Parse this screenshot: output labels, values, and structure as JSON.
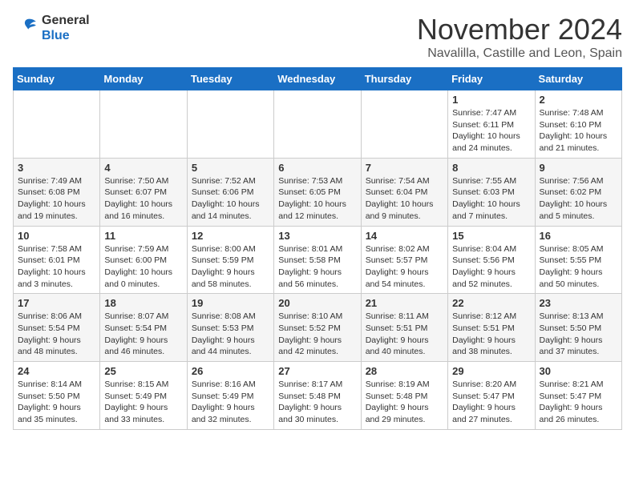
{
  "logo": {
    "line1": "General",
    "line2": "Blue"
  },
  "title": "November 2024",
  "location": "Navalilla, Castille and Leon, Spain",
  "weekdays": [
    "Sunday",
    "Monday",
    "Tuesday",
    "Wednesday",
    "Thursday",
    "Friday",
    "Saturday"
  ],
  "weeks": [
    [
      {
        "day": "",
        "info": ""
      },
      {
        "day": "",
        "info": ""
      },
      {
        "day": "",
        "info": ""
      },
      {
        "day": "",
        "info": ""
      },
      {
        "day": "",
        "info": ""
      },
      {
        "day": "1",
        "info": "Sunrise: 7:47 AM\nSunset: 6:11 PM\nDaylight: 10 hours\nand 24 minutes."
      },
      {
        "day": "2",
        "info": "Sunrise: 7:48 AM\nSunset: 6:10 PM\nDaylight: 10 hours\nand 21 minutes."
      }
    ],
    [
      {
        "day": "3",
        "info": "Sunrise: 7:49 AM\nSunset: 6:08 PM\nDaylight: 10 hours\nand 19 minutes."
      },
      {
        "day": "4",
        "info": "Sunrise: 7:50 AM\nSunset: 6:07 PM\nDaylight: 10 hours\nand 16 minutes."
      },
      {
        "day": "5",
        "info": "Sunrise: 7:52 AM\nSunset: 6:06 PM\nDaylight: 10 hours\nand 14 minutes."
      },
      {
        "day": "6",
        "info": "Sunrise: 7:53 AM\nSunset: 6:05 PM\nDaylight: 10 hours\nand 12 minutes."
      },
      {
        "day": "7",
        "info": "Sunrise: 7:54 AM\nSunset: 6:04 PM\nDaylight: 10 hours\nand 9 minutes."
      },
      {
        "day": "8",
        "info": "Sunrise: 7:55 AM\nSunset: 6:03 PM\nDaylight: 10 hours\nand 7 minutes."
      },
      {
        "day": "9",
        "info": "Sunrise: 7:56 AM\nSunset: 6:02 PM\nDaylight: 10 hours\nand 5 minutes."
      }
    ],
    [
      {
        "day": "10",
        "info": "Sunrise: 7:58 AM\nSunset: 6:01 PM\nDaylight: 10 hours\nand 3 minutes."
      },
      {
        "day": "11",
        "info": "Sunrise: 7:59 AM\nSunset: 6:00 PM\nDaylight: 10 hours\nand 0 minutes."
      },
      {
        "day": "12",
        "info": "Sunrise: 8:00 AM\nSunset: 5:59 PM\nDaylight: 9 hours\nand 58 minutes."
      },
      {
        "day": "13",
        "info": "Sunrise: 8:01 AM\nSunset: 5:58 PM\nDaylight: 9 hours\nand 56 minutes."
      },
      {
        "day": "14",
        "info": "Sunrise: 8:02 AM\nSunset: 5:57 PM\nDaylight: 9 hours\nand 54 minutes."
      },
      {
        "day": "15",
        "info": "Sunrise: 8:04 AM\nSunset: 5:56 PM\nDaylight: 9 hours\nand 52 minutes."
      },
      {
        "day": "16",
        "info": "Sunrise: 8:05 AM\nSunset: 5:55 PM\nDaylight: 9 hours\nand 50 minutes."
      }
    ],
    [
      {
        "day": "17",
        "info": "Sunrise: 8:06 AM\nSunset: 5:54 PM\nDaylight: 9 hours\nand 48 minutes."
      },
      {
        "day": "18",
        "info": "Sunrise: 8:07 AM\nSunset: 5:54 PM\nDaylight: 9 hours\nand 46 minutes."
      },
      {
        "day": "19",
        "info": "Sunrise: 8:08 AM\nSunset: 5:53 PM\nDaylight: 9 hours\nand 44 minutes."
      },
      {
        "day": "20",
        "info": "Sunrise: 8:10 AM\nSunset: 5:52 PM\nDaylight: 9 hours\nand 42 minutes."
      },
      {
        "day": "21",
        "info": "Sunrise: 8:11 AM\nSunset: 5:51 PM\nDaylight: 9 hours\nand 40 minutes."
      },
      {
        "day": "22",
        "info": "Sunrise: 8:12 AM\nSunset: 5:51 PM\nDaylight: 9 hours\nand 38 minutes."
      },
      {
        "day": "23",
        "info": "Sunrise: 8:13 AM\nSunset: 5:50 PM\nDaylight: 9 hours\nand 37 minutes."
      }
    ],
    [
      {
        "day": "24",
        "info": "Sunrise: 8:14 AM\nSunset: 5:50 PM\nDaylight: 9 hours\nand 35 minutes."
      },
      {
        "day": "25",
        "info": "Sunrise: 8:15 AM\nSunset: 5:49 PM\nDaylight: 9 hours\nand 33 minutes."
      },
      {
        "day": "26",
        "info": "Sunrise: 8:16 AM\nSunset: 5:49 PM\nDaylight: 9 hours\nand 32 minutes."
      },
      {
        "day": "27",
        "info": "Sunrise: 8:17 AM\nSunset: 5:48 PM\nDaylight: 9 hours\nand 30 minutes."
      },
      {
        "day": "28",
        "info": "Sunrise: 8:19 AM\nSunset: 5:48 PM\nDaylight: 9 hours\nand 29 minutes."
      },
      {
        "day": "29",
        "info": "Sunrise: 8:20 AM\nSunset: 5:47 PM\nDaylight: 9 hours\nand 27 minutes."
      },
      {
        "day": "30",
        "info": "Sunrise: 8:21 AM\nSunset: 5:47 PM\nDaylight: 9 hours\nand 26 minutes."
      }
    ]
  ]
}
